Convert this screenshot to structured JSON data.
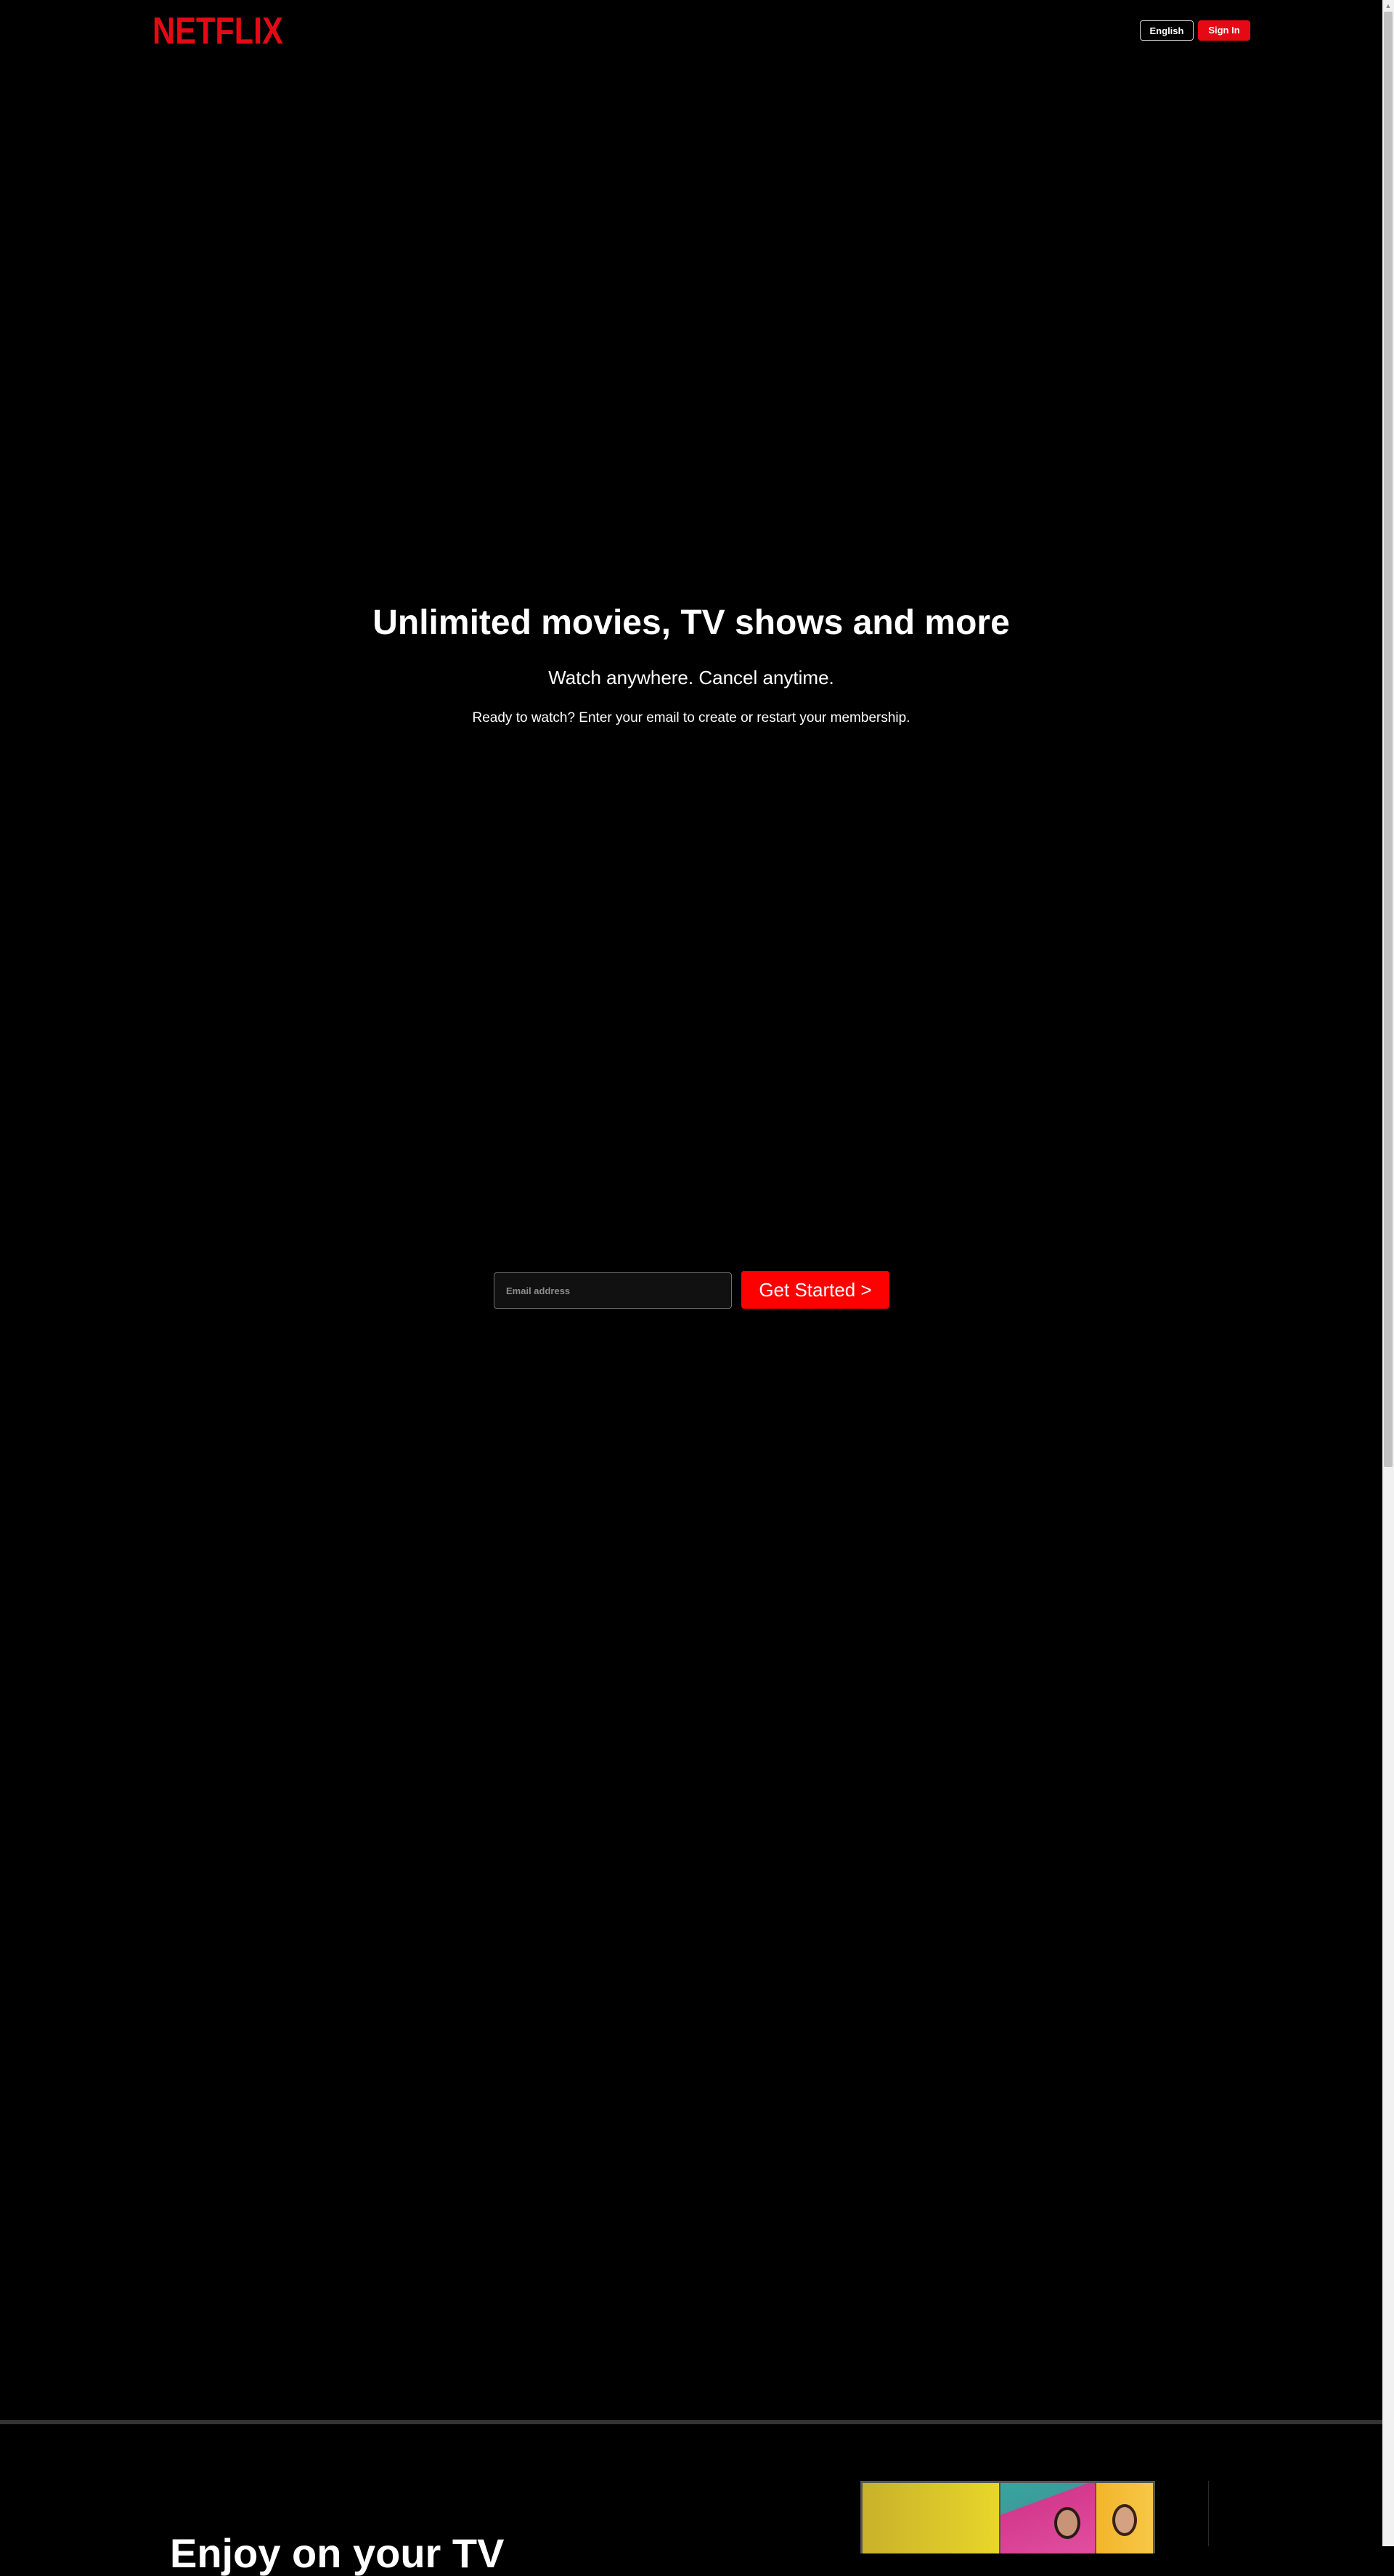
{
  "header": {
    "logo_text": "NETFLIX",
    "language_label": "English",
    "signin_label": "Sign In"
  },
  "hero": {
    "title": "Unlimited movies, TV shows and more",
    "subtitle": "Watch anywhere. Cancel anytime.",
    "cta_text": "Ready to watch? Enter your email to create or restart your membership."
  },
  "form": {
    "email_placeholder": "Email address",
    "button_label": "Get Started >"
  },
  "section": {
    "title": "Enjoy on your TV"
  },
  "colors": {
    "brand_red": "#e50914",
    "button_red": "#ff0000",
    "background": "#000000"
  },
  "icons": {
    "logo": "netflix-wordmark",
    "scroll_up": "arrow-up-icon"
  }
}
